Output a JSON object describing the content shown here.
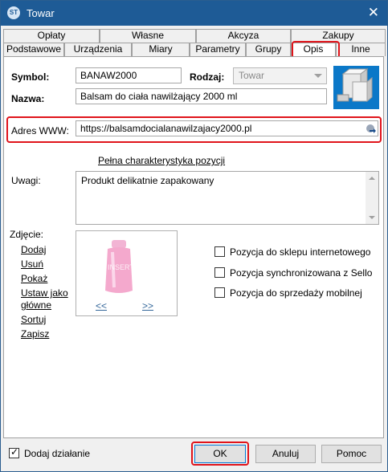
{
  "window": {
    "title": "Towar",
    "app_icon_text": "ST"
  },
  "tabs": {
    "row1": [
      {
        "label": "Opłaty"
      },
      {
        "label": "Własne"
      },
      {
        "label": "Akcyza"
      },
      {
        "label": "Zakupy"
      }
    ],
    "row2": [
      {
        "label": "Podstawowe"
      },
      {
        "label": "Urządzenia"
      },
      {
        "label": "Miary"
      },
      {
        "label": "Parametry"
      },
      {
        "label": "Grupy"
      },
      {
        "label": "Opis"
      },
      {
        "label": "Inne"
      }
    ],
    "selected": "Opis"
  },
  "form": {
    "symbol_label": "Symbol:",
    "symbol_value": "BANAW2000",
    "rodzaj_label": "Rodzaj:",
    "rodzaj_value": "Towar",
    "nazwa_label": "Nazwa:",
    "nazwa_value": "Balsam do ciała nawilżający 2000 ml",
    "www_label": "Adres WWW:",
    "www_value": "https://balsamdocialanawilzajacy2000.pl",
    "characteristics_link": "Pełna charakterystyka pozycji",
    "uwagi_label": "Uwagi:",
    "uwagi_value": "Produkt delikatnie zapakowany"
  },
  "photo": {
    "label": "Zdjęcie:",
    "actions": [
      "Dodaj",
      "Usuń",
      "Pokaż",
      "Ustaw jako",
      "główne",
      "Sortuj",
      "Zapisz"
    ],
    "prev": "<<",
    "next": ">>",
    "watermark": "INSERT"
  },
  "options": [
    {
      "label": "Pozycja do sklepu internetowego",
      "checked": false
    },
    {
      "label": "Pozycja synchronizowana z Sello",
      "checked": false
    },
    {
      "label": "Pozycja do sprzedaży mobilnej",
      "checked": false
    }
  ],
  "footer": {
    "add_action_label": "Dodaj działanie",
    "add_action_checked": true,
    "ok": "OK",
    "cancel": "Anuluj",
    "help": "Pomoc"
  },
  "colors": {
    "title_bar": "#1e5b96",
    "highlight": "#e0141b"
  }
}
